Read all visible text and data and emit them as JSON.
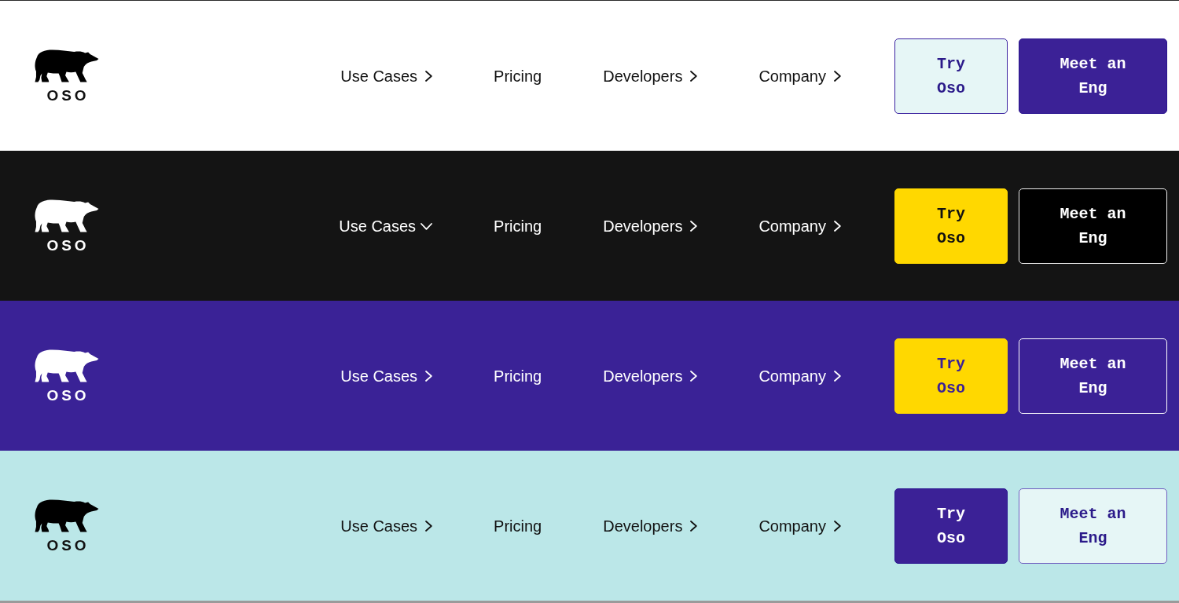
{
  "navbars": [
    {
      "logo": {
        "wordmark": "OSO"
      },
      "nav_items": [
        {
          "label": "Use Cases",
          "kind": "menu",
          "expanded": false
        },
        {
          "label": "Pricing",
          "kind": "link"
        },
        {
          "label": "Developers",
          "kind": "menu",
          "expanded": false
        },
        {
          "label": "Company",
          "kind": "menu",
          "expanded": false
        }
      ],
      "buttons": [
        {
          "label": "Try Oso"
        },
        {
          "label": "Meet an Eng"
        }
      ]
    },
    {
      "logo": {
        "wordmark": "OSO"
      },
      "nav_items": [
        {
          "label": "Use Cases",
          "kind": "menu",
          "expanded": true
        },
        {
          "label": "Pricing",
          "kind": "link"
        },
        {
          "label": "Developers",
          "kind": "menu",
          "expanded": false
        },
        {
          "label": "Company",
          "kind": "menu",
          "expanded": false
        }
      ],
      "buttons": [
        {
          "label": "Try Oso"
        },
        {
          "label": "Meet an Eng"
        }
      ]
    },
    {
      "logo": {
        "wordmark": "OSO"
      },
      "nav_items": [
        {
          "label": "Use Cases",
          "kind": "menu",
          "expanded": false
        },
        {
          "label": "Pricing",
          "kind": "link"
        },
        {
          "label": "Developers",
          "kind": "menu",
          "expanded": false
        },
        {
          "label": "Company",
          "kind": "menu",
          "expanded": false
        }
      ],
      "buttons": [
        {
          "label": "Try Oso"
        },
        {
          "label": "Meet an Eng"
        }
      ]
    },
    {
      "logo": {
        "wordmark": "OSO"
      },
      "nav_items": [
        {
          "label": "Use Cases",
          "kind": "menu",
          "expanded": false
        },
        {
          "label": "Pricing",
          "kind": "link"
        },
        {
          "label": "Developers",
          "kind": "menu",
          "expanded": false
        },
        {
          "label": "Company",
          "kind": "menu",
          "expanded": false
        }
      ],
      "buttons": [
        {
          "label": "Try Oso"
        },
        {
          "label": "Meet an Eng"
        }
      ]
    }
  ]
}
